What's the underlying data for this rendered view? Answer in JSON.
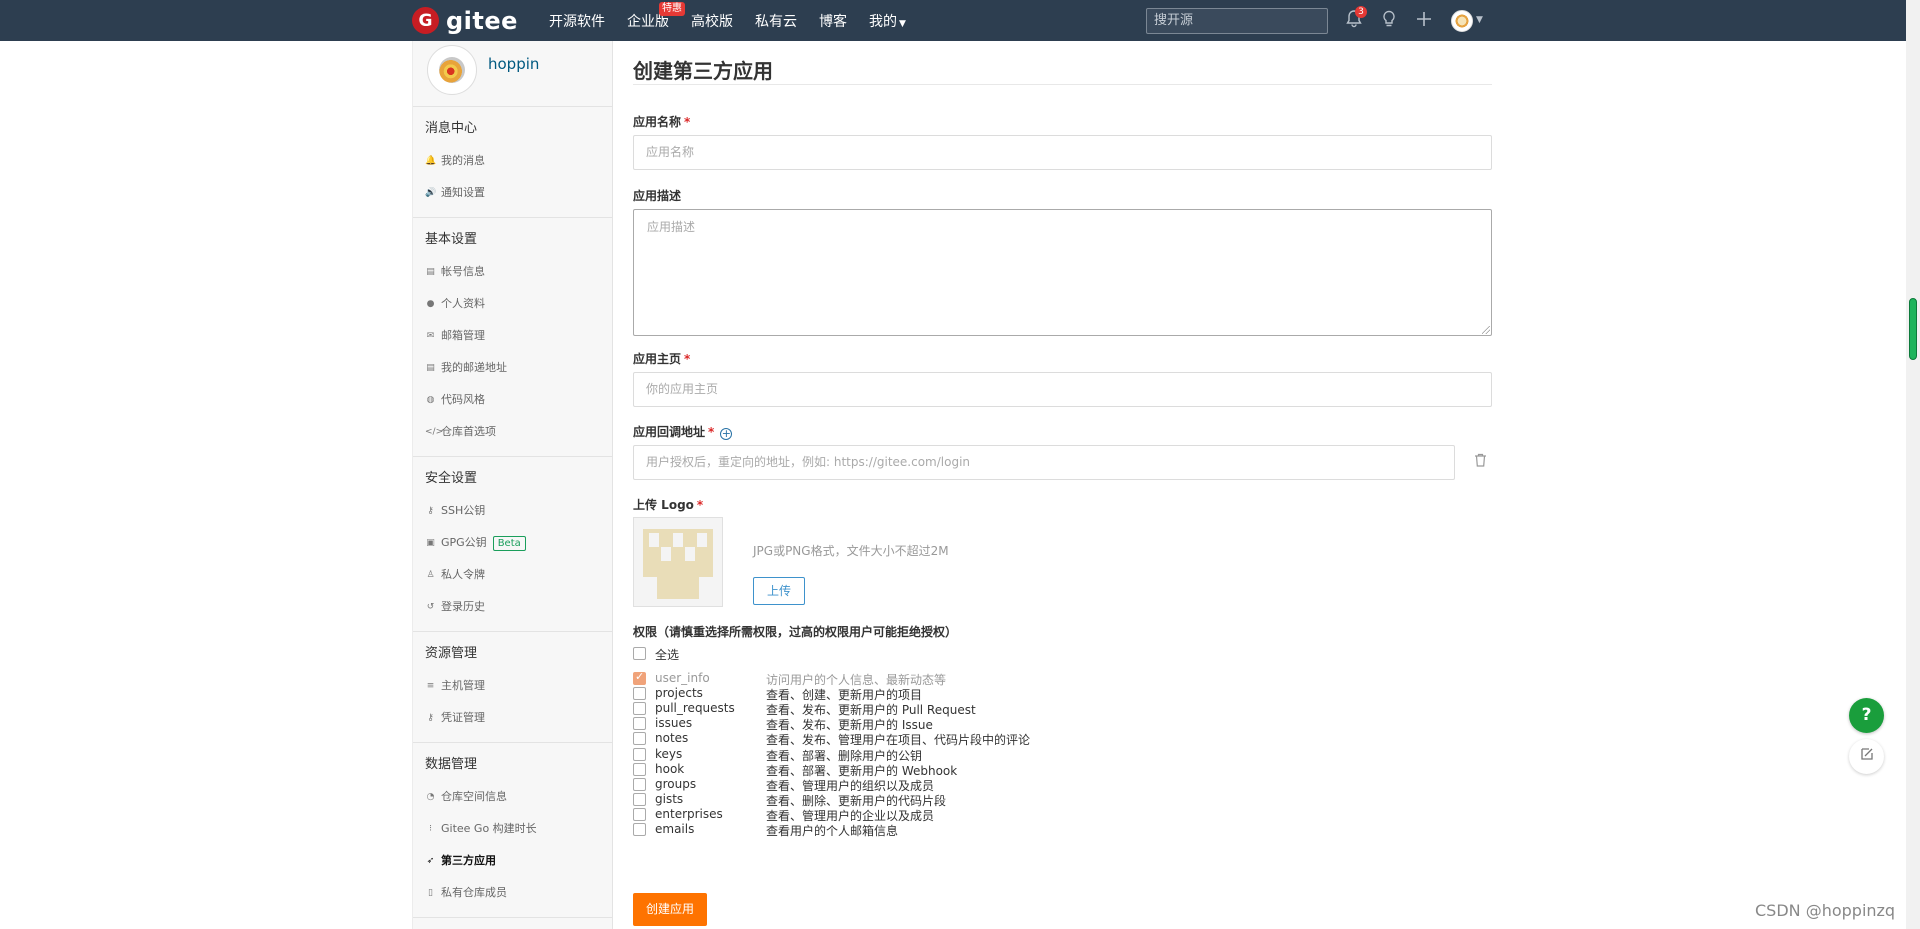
{
  "navbar": {
    "logo_text": "gitee",
    "items": [
      {
        "label": "开源软件"
      },
      {
        "label": "企业版",
        "badge": "特惠"
      },
      {
        "label": "高校版"
      },
      {
        "label": "私有云"
      },
      {
        "label": "博客"
      },
      {
        "label": "我的"
      }
    ],
    "search_placeholder": "搜开源",
    "notification_count": "3"
  },
  "sidebar": {
    "username": "hoppin",
    "groups": [
      {
        "title": "消息中心",
        "items": [
          {
            "label": "我的消息",
            "icon": "bell-icon"
          },
          {
            "label": "通知设置",
            "icon": "volume-icon"
          }
        ]
      },
      {
        "title": "基本设置",
        "items": [
          {
            "label": "帐号信息",
            "icon": "id-card-icon"
          },
          {
            "label": "个人资料",
            "icon": "user-icon"
          },
          {
            "label": "邮箱管理",
            "icon": "mail-icon"
          },
          {
            "label": "我的邮递地址",
            "icon": "address-card-icon"
          },
          {
            "label": "代码风格",
            "icon": "palette-icon"
          },
          {
            "label": "仓库首选项",
            "icon": "code-icon"
          }
        ]
      },
      {
        "title": "安全设置",
        "items": [
          {
            "label": "SSH公钥",
            "icon": "key-icon"
          },
          {
            "label": "GPG公钥",
            "icon": "lock-icon",
            "tag": "Beta"
          },
          {
            "label": "私人令牌",
            "icon": "token-icon"
          },
          {
            "label": "登录历史",
            "icon": "history-icon"
          }
        ]
      },
      {
        "title": "资源管理",
        "items": [
          {
            "label": "主机管理",
            "icon": "server-icon"
          },
          {
            "label": "凭证管理",
            "icon": "credential-key-icon"
          }
        ]
      },
      {
        "title": "数据管理",
        "items": [
          {
            "label": "仓库空间信息",
            "icon": "pie-chart-icon"
          },
          {
            "label": "Gitee Go 构建时长",
            "icon": "build-icon"
          },
          {
            "label": "第三方应用",
            "icon": "rocket-icon",
            "active": true
          },
          {
            "label": "私有仓库成员",
            "icon": "book-icon"
          }
        ]
      }
    ]
  },
  "form": {
    "title": "创建第三方应用",
    "name_label": "应用名称",
    "name_placeholder": "应用名称",
    "desc_label": "应用描述",
    "desc_placeholder": "应用描述",
    "homepage_label": "应用主页",
    "homepage_placeholder": "你的应用主页",
    "callback_label": "应用回调地址",
    "callback_placeholder": "用户授权后，重定向的地址，例如: https://gitee.com/login",
    "logo_label": "上传 Logo",
    "logo_hint": "JPG或PNG格式，文件大小不超过2M",
    "upload_button": "上传",
    "permissions_title": "权限（请慎重选择所需权限，过高的权限用户可能拒绝授权）",
    "select_all_label": "全选",
    "permissions": [
      {
        "name": "user_info",
        "desc": "访问用户的个人信息、最新动态等",
        "checked": true
      },
      {
        "name": "projects",
        "desc": "查看、创建、更新用户的项目",
        "checked": false
      },
      {
        "name": "pull_requests",
        "desc": "查看、发布、更新用户的 Pull Request",
        "checked": false
      },
      {
        "name": "issues",
        "desc": "查看、发布、更新用户的 Issue",
        "checked": false
      },
      {
        "name": "notes",
        "desc": "查看、发布、管理用户在项目、代码片段中的评论",
        "checked": false
      },
      {
        "name": "keys",
        "desc": "查看、部署、删除用户的公钥",
        "checked": false
      },
      {
        "name": "hook",
        "desc": "查看、部署、更新用户的 Webhook",
        "checked": false
      },
      {
        "name": "groups",
        "desc": "查看、管理用户的组织以及成员",
        "checked": false
      },
      {
        "name": "gists",
        "desc": "查看、删除、更新用户的代码片段",
        "checked": false
      },
      {
        "name": "enterprises",
        "desc": "查看、管理用户的企业以及成员",
        "checked": false
      },
      {
        "name": "emails",
        "desc": "查看用户的个人邮箱信息",
        "checked": false
      }
    ],
    "submit_button": "创建应用"
  },
  "floating": {
    "help_label": "?"
  },
  "watermark": "CSDN @hoppinzq",
  "colors": {
    "navbar": "#2d3e50",
    "primary_orange": "#fe7300",
    "link_blue": "#005980",
    "help_green": "#1a9e3c",
    "required_red": "#db2828"
  }
}
